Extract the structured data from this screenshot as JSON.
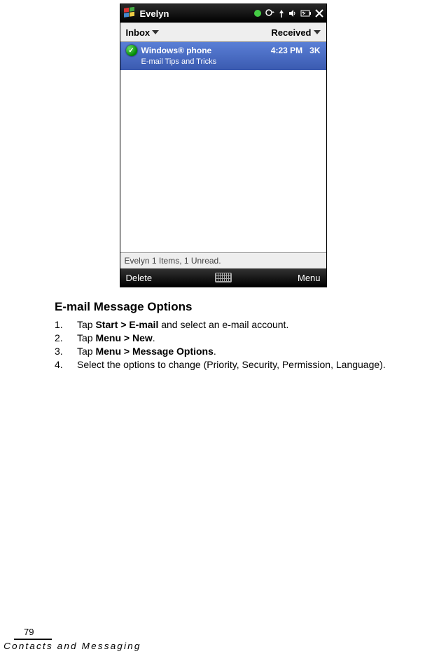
{
  "phone": {
    "status_title": "Evelyn",
    "header": {
      "inbox": "Inbox",
      "received": "Received"
    },
    "message": {
      "sender": "Windows® phone",
      "time": "4:23 PM",
      "size": "3K",
      "subject": "E-mail Tips and Tricks"
    },
    "footer_status": "Evelyn  1 Items, 1 Unread.",
    "softkeys": {
      "left": "Delete",
      "right": "Menu"
    }
  },
  "doc": {
    "heading": "E-mail Message Options",
    "steps": [
      {
        "n": "1.",
        "pre": "Tap ",
        "bold": "Start > E-mail",
        "post": " and select an e-mail account."
      },
      {
        "n": "2.",
        "pre": "Tap ",
        "bold": "Menu > New",
        "post": "."
      },
      {
        "n": "3.",
        "pre": "Tap ",
        "bold": "Menu > Message Options",
        "post": "."
      },
      {
        "n": "4.",
        "pre": "",
        "bold": "",
        "post": "Select the options to change (Priority, Security, Permission, Language)."
      }
    ]
  },
  "footer": {
    "page_number": "79",
    "chapter": "Contacts and Messaging"
  }
}
